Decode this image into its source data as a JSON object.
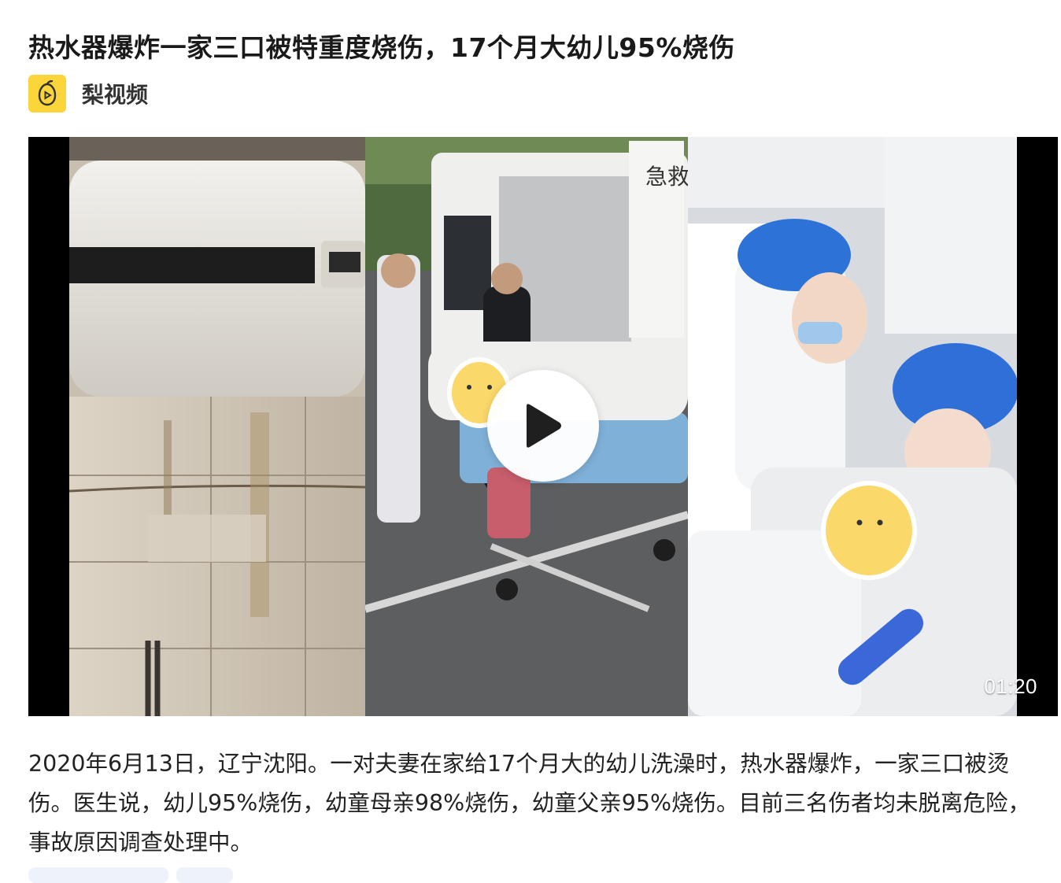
{
  "article": {
    "title": "热水器爆炸一家三口被特重度烧伤，17个月大幼儿95%烧伤",
    "source_name": "梨视频",
    "source_icon": "pear-video-logo-icon",
    "brand_color": "#fbd53a"
  },
  "video": {
    "duration": "01:20",
    "play_icon": "play-icon",
    "sign_text": "急救"
  },
  "description": "2020年6月13日，辽宁沈阳。一对夫妻在家给17个月大的幼儿洗澡时，热水器爆炸，一家三口被烫伤。医生说，幼儿95%烧伤，幼童母亲98%烧伤，幼童父亲95%烧伤。目前三名伤者均未脱离危险，事故原因调查处理中。"
}
